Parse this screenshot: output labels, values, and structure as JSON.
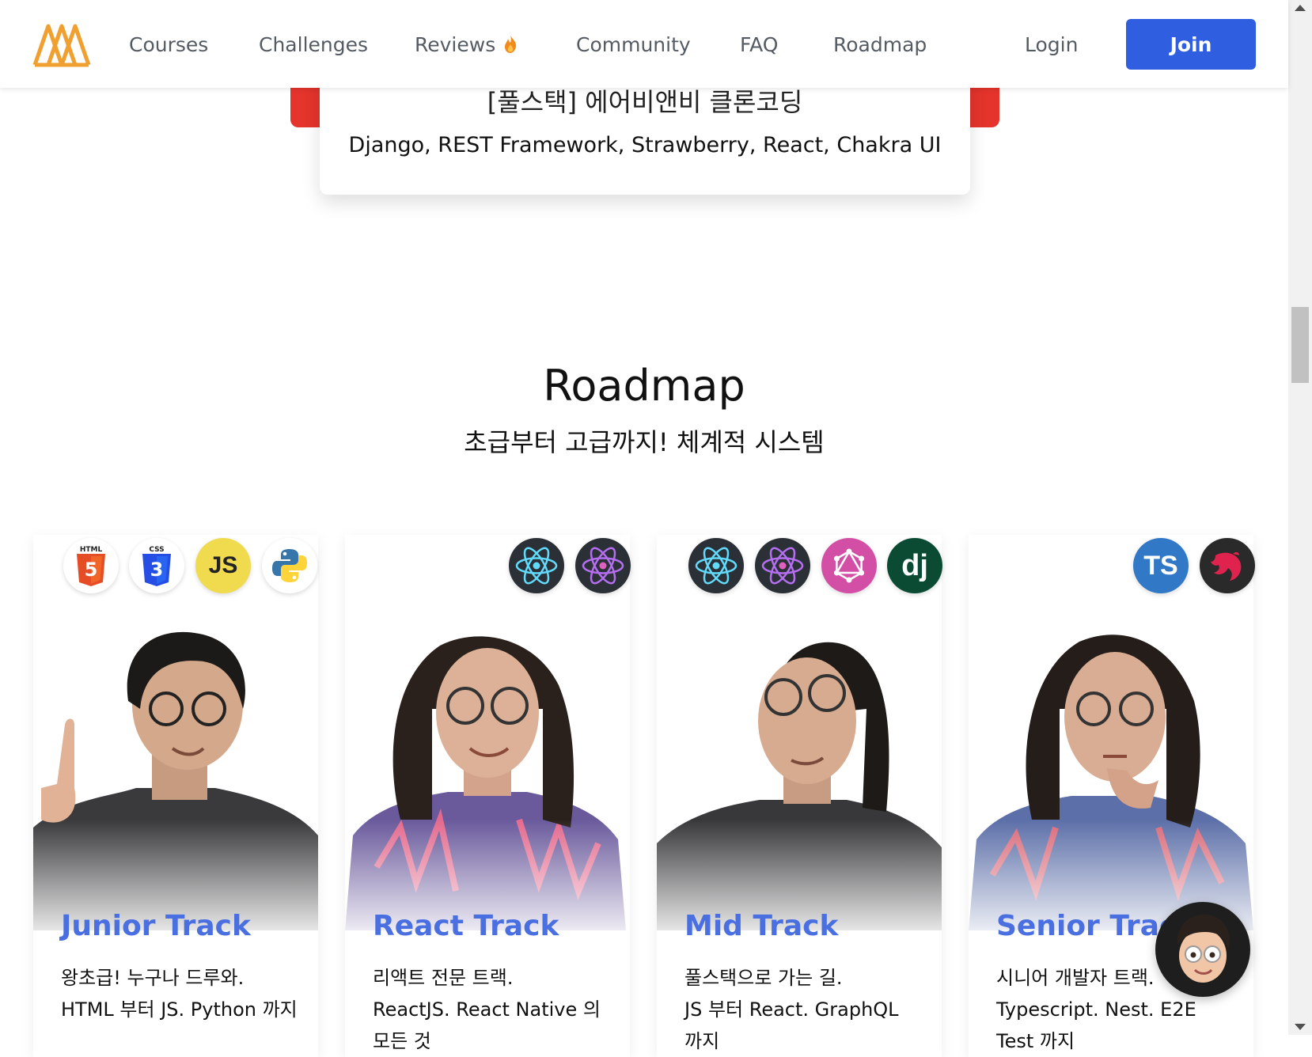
{
  "header": {
    "nav": [
      {
        "label": "Courses"
      },
      {
        "label": "Challenges"
      },
      {
        "label": "Reviews"
      },
      {
        "label": "Community"
      },
      {
        "label": "FAQ"
      },
      {
        "label": "Roadmap"
      }
    ],
    "login_label": "Login",
    "join_label": "Join"
  },
  "course": {
    "title": "[풀스택] 에어비앤비 클론코딩",
    "stack": "Django, REST Framework, Strawberry, React, Chakra UI"
  },
  "roadmap": {
    "title": "Roadmap",
    "subtitle": "초급부터 고급까지! 체계적 시스템",
    "tracks": [
      {
        "title": "Junior Track",
        "line1": "왕초급! 누구나 드루와.",
        "line2": "HTML 부터 JS. Python 까지",
        "icons": [
          "html5-icon",
          "css3-icon",
          "javascript-icon",
          "python-icon"
        ]
      },
      {
        "title": "React Track",
        "line1": "리액트 전문 트랙.",
        "line2": "ReactJS. React Native 의 모든 것",
        "icons": [
          "react-icon",
          "react-native-icon"
        ]
      },
      {
        "title": "Mid Track",
        "line1": "풀스택으로 가는 길.",
        "line2": "JS 부터 React. GraphQL 까지",
        "icons": [
          "react-icon",
          "react-native-icon",
          "graphql-icon",
          "django-icon"
        ]
      },
      {
        "title": "Senior Track",
        "line1": "시니어 개발자 트랙.",
        "line2": "Typescript. Nest. E2E Test 까지",
        "icons": [
          "typescript-icon",
          "nestjs-icon"
        ]
      }
    ]
  },
  "icon_text": {
    "js": "JS",
    "ts": "TS",
    "dj": "dj",
    "html": "HTML",
    "css": "CSS"
  },
  "colors": {
    "accent": "#2f5fe0",
    "track_title": "#4a6fe0",
    "banner_red": "#e4342c",
    "logo_orange": "#f0a030"
  }
}
